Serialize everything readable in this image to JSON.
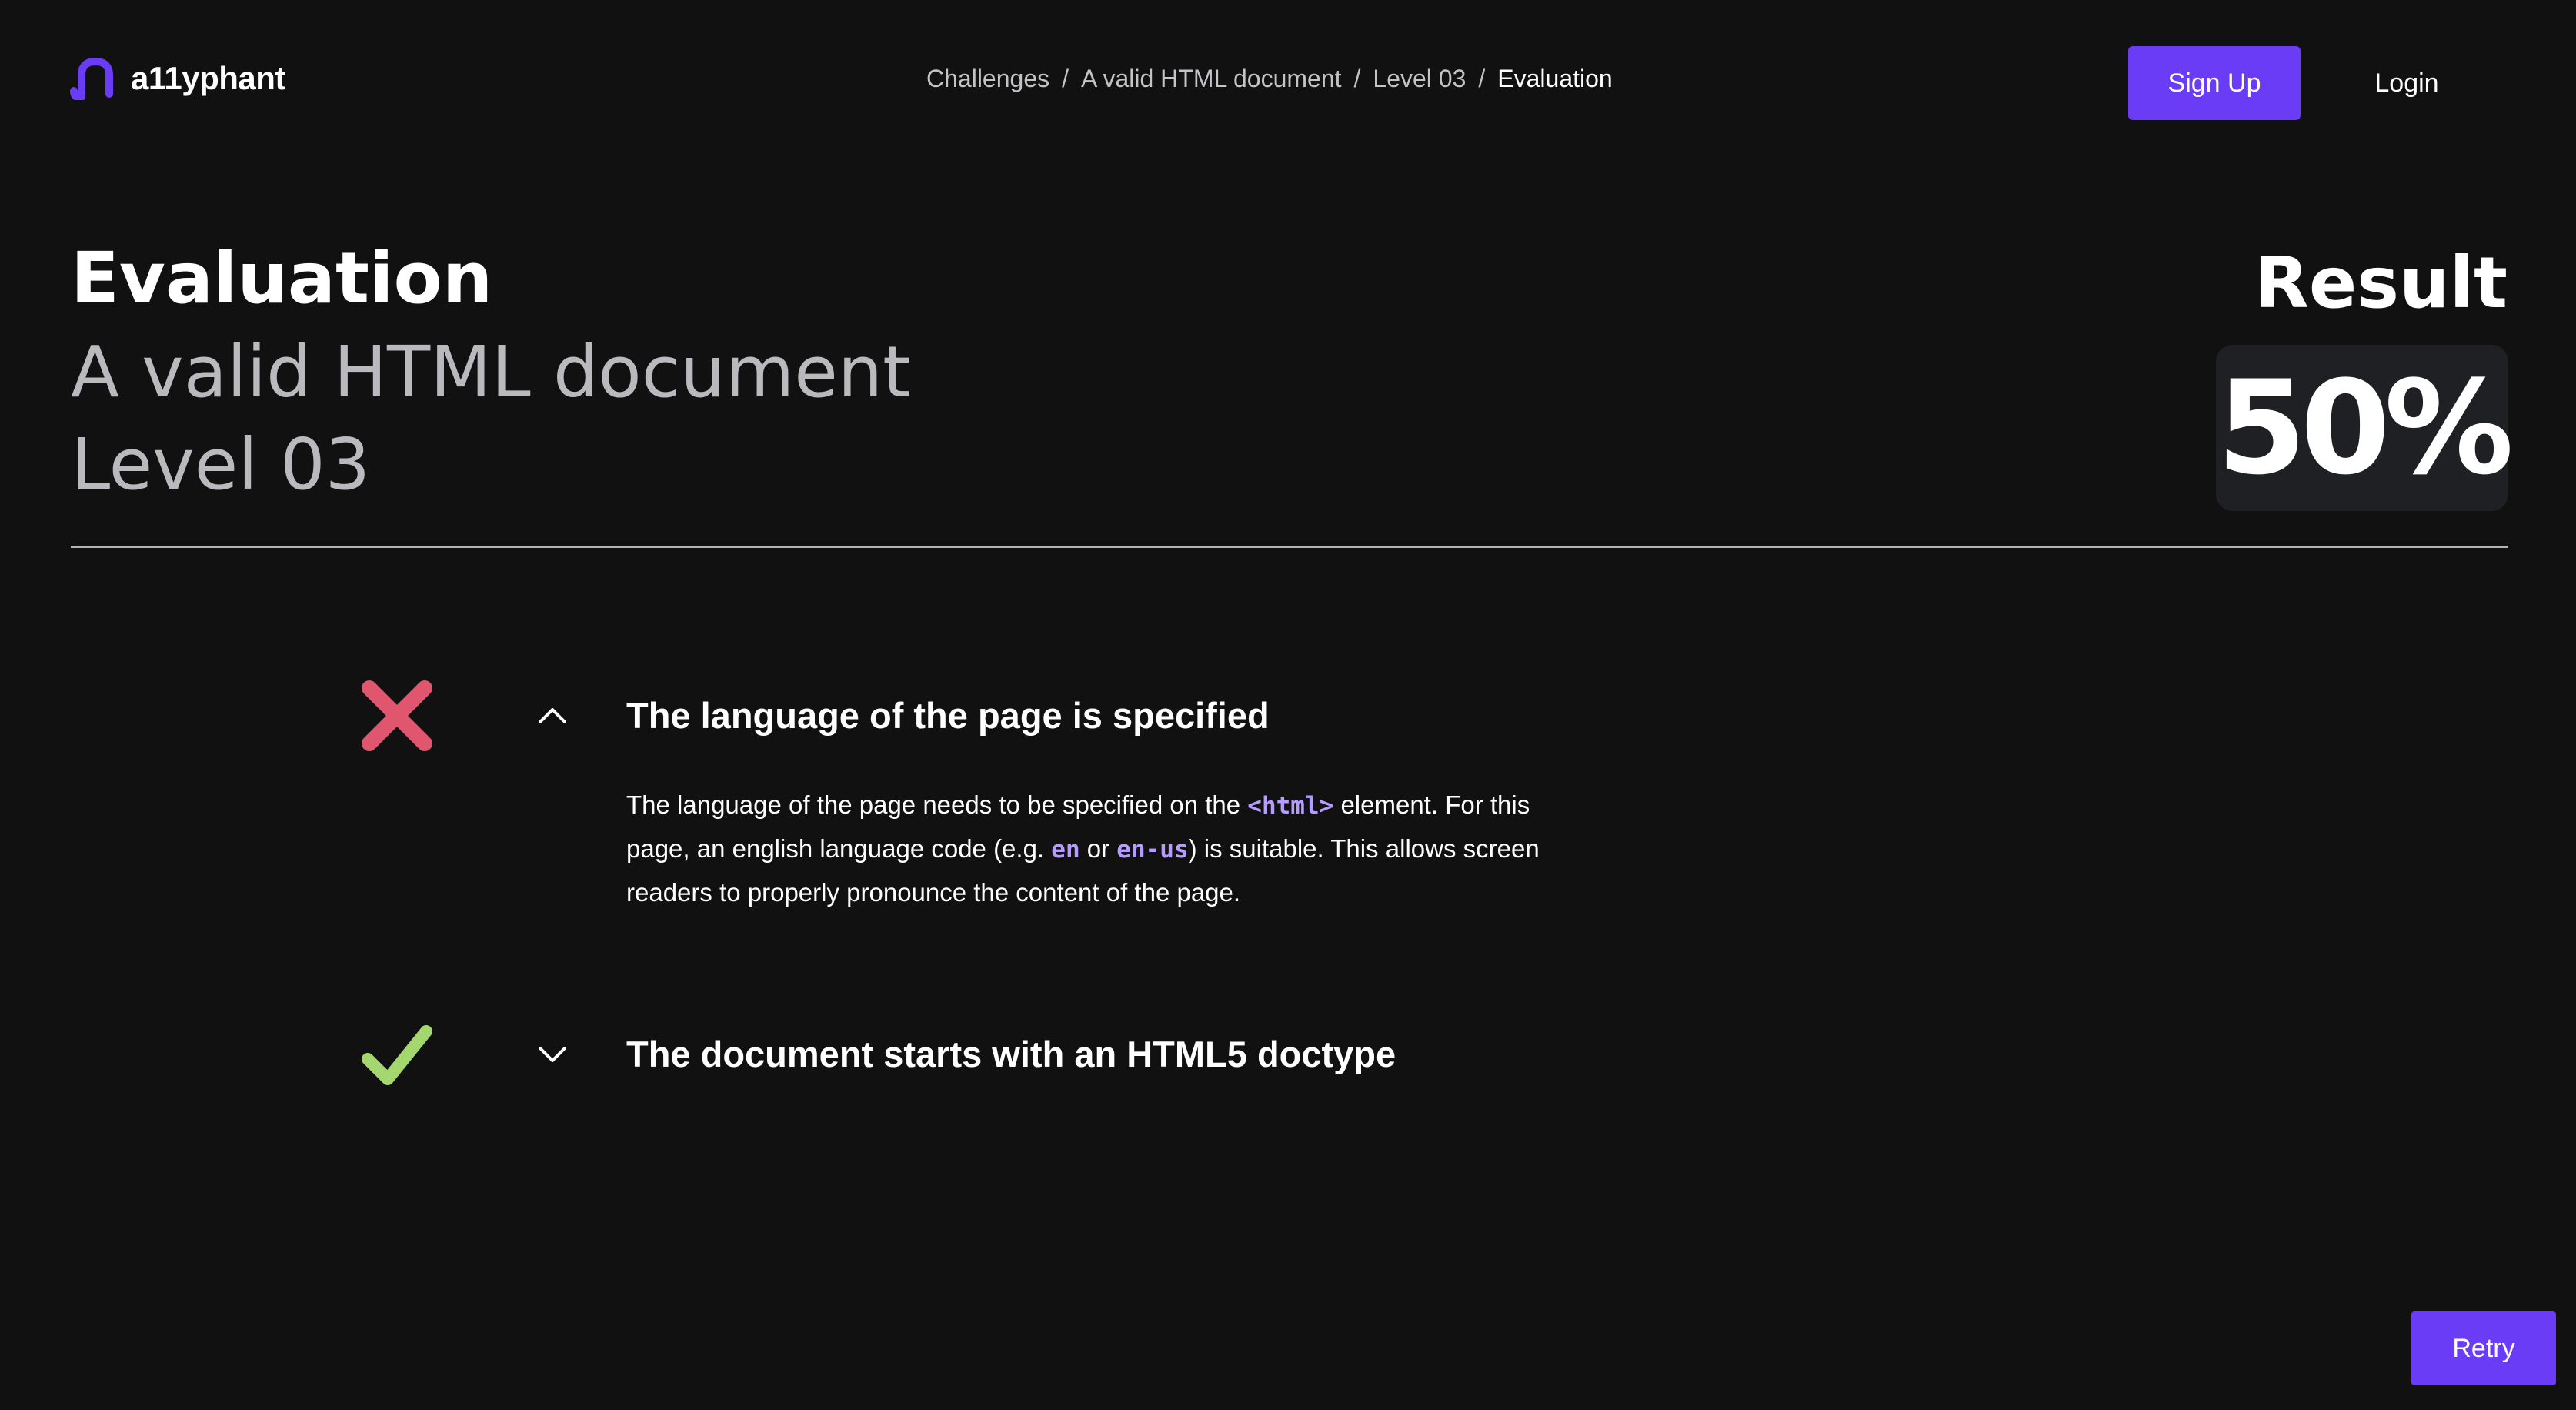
{
  "header": {
    "logo_text": "a11yphant",
    "breadcrumbs": [
      {
        "label": "Challenges"
      },
      {
        "label": "A valid HTML document"
      },
      {
        "label": "Level 03"
      },
      {
        "label": "Evaluation"
      }
    ],
    "separator": "/",
    "signup_label": "Sign Up",
    "login_label": "Login"
  },
  "main": {
    "title": "Evaluation",
    "challenge_name": "A valid HTML document",
    "level": "Level 03",
    "result_label": "Result",
    "result_value": "50%"
  },
  "checks": [
    {
      "status": "failed",
      "status_icon": "cross-icon",
      "status_color": "#e0566f",
      "expanded": true,
      "toggle_icon": "chevron-up-icon",
      "title": "The language of the page is specified",
      "description": {
        "part1": "The language of the page needs to be specified on the ",
        "code1": "<html>",
        "part2": " element. For this page, an english language code (e.g. ",
        "code2": "en",
        "part3": " or ",
        "code3": "en-us",
        "part4": ") is suitable. This allows screen readers to properly pronounce the content of the page."
      }
    },
    {
      "status": "passed",
      "status_icon": "checkmark-icon",
      "status_color": "#a4d86e",
      "expanded": false,
      "toggle_icon": "chevron-down-icon",
      "title": "The document starts with an HTML5 doctype"
    }
  ],
  "footer": {
    "retry_label": "Retry"
  },
  "colors": {
    "background": "#111112",
    "accent": "#6b3cf5",
    "code": "#b79cff",
    "result_box": "#1f2024"
  }
}
